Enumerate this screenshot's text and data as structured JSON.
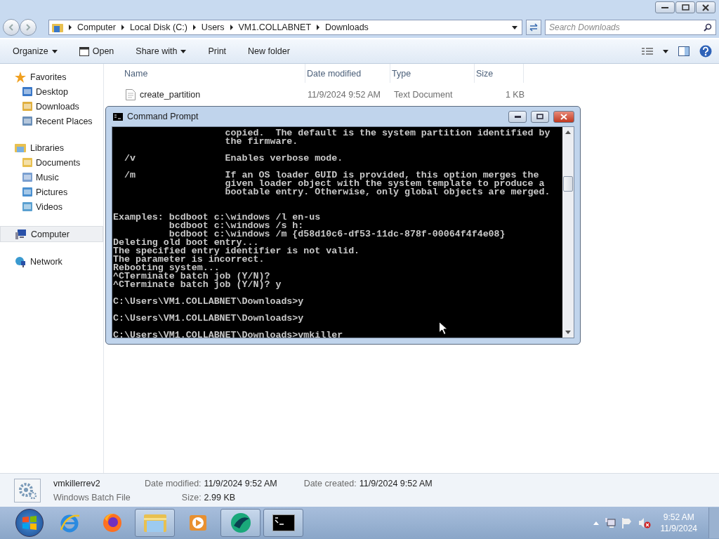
{
  "explorer": {
    "breadcrumb": [
      "Computer",
      "Local Disk (C:)",
      "Users",
      "VM1.COLLABNET",
      "Downloads"
    ],
    "search": {
      "placeholder": "Search Downloads"
    },
    "toolbar": [
      {
        "label": "Organize",
        "kind": "menu"
      },
      {
        "label": "Open",
        "kind": "icon"
      },
      {
        "label": "Share with",
        "kind": "menu"
      },
      {
        "label": "Print",
        "kind": "plain"
      },
      {
        "label": "New folder",
        "kind": "plain"
      }
    ],
    "sidebar": [
      {
        "label": "Favorites",
        "selected": false,
        "children": [
          {
            "label": "Desktop",
            "selected": false
          },
          {
            "label": "Downloads",
            "selected": false
          },
          {
            "label": "Recent Places",
            "selected": false
          }
        ]
      },
      {
        "label": "Libraries",
        "selected": false,
        "children": [
          {
            "label": "Documents",
            "selected": false
          },
          {
            "label": "Music",
            "selected": false
          },
          {
            "label": "Pictures",
            "selected": false
          },
          {
            "label": "Videos",
            "selected": false
          }
        ]
      },
      {
        "label": "Computer",
        "selected": true
      },
      {
        "label": "Network",
        "selected": false
      }
    ],
    "columns": [
      "Name",
      "Date modified",
      "Type",
      "Size"
    ],
    "rows": [
      [
        "create_partition",
        "11/9/2024 9:52 AM",
        "Text Document",
        "1 KB"
      ]
    ],
    "details": {
      "name": "vmkillerrev2",
      "type": "Windows Batch File",
      "fields": [
        {
          "label": "Date modified:",
          "value": "11/9/2024 9:52 AM"
        },
        {
          "label": "Size:",
          "value": "2.99 KB"
        },
        {
          "label": "Date created:",
          "value": "11/9/2024 9:52 AM"
        }
      ]
    }
  },
  "command_prompt": {
    "title": "Command Prompt",
    "blocks": [
      [
        "                    copied.  The default is the system partition identified by",
        "                    the firmware."
      ],
      [
        "  /v                Enables verbose mode."
      ],
      [
        "  /m                If an OS loader GUID is provided, this option merges the",
        "                    given loader object with the system template to produce a",
        "                    bootable entry. Otherwise, only global objects are merged."
      ],
      [
        "Examples: bcdboot c:\\windows /l en-us",
        "          bcdboot c:\\windows /s h:",
        "          bcdboot c:\\windows /m {d58d10c6-df53-11dc-878f-00064f4f4e08}",
        "Deleting old boot entry...",
        "The specified entry identifier is not valid.",
        "The parameter is incorrect.",
        "Rebooting system...",
        "^CTerminate batch job (Y/N)?",
        "^CTerminate batch job (Y/N)? y"
      ],
      [
        "C:\\Users\\VM1.COLLABNET\\Downloads>y"
      ],
      [
        "C:\\Users\\VM1.COLLABNET\\Downloads>y"
      ],
      [
        "C:\\Users\\VM1.COLLABNET\\Downloads>vmkiller"
      ]
    ]
  },
  "taskbar": {
    "apps": [
      {
        "kind": "ie",
        "active": false
      },
      {
        "kind": "firefox",
        "active": false
      },
      {
        "kind": "folder",
        "active": true
      },
      {
        "kind": "media",
        "active": false
      },
      {
        "kind": "globe",
        "active": true
      },
      {
        "kind": "console",
        "active": true
      }
    ],
    "time": "9:52 AM",
    "date": "11/9/2024"
  }
}
